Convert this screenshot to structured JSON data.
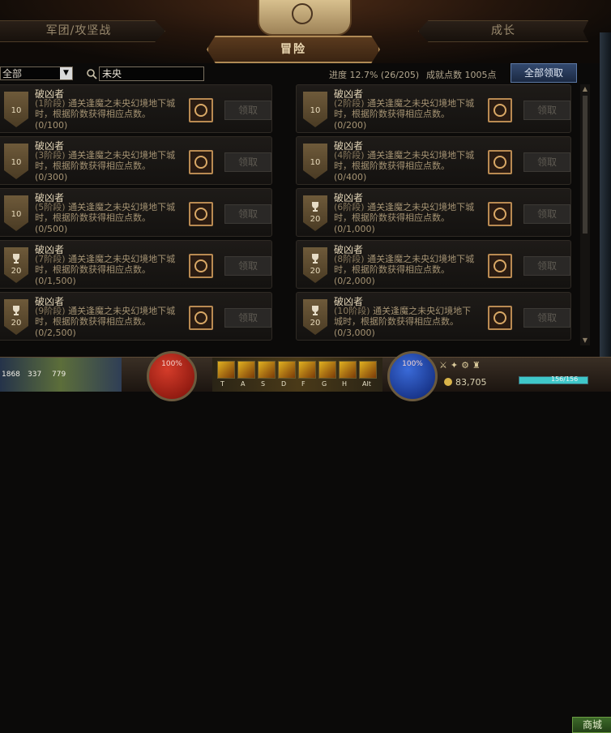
{
  "header": {
    "tab_left": "军团/攻坚战",
    "tab_active": "冒险",
    "tab_right": "成长"
  },
  "filter": {
    "category": "全部",
    "search_value": "未央"
  },
  "summary": {
    "progress": "进度 12.7% (26/205)",
    "points": "成就点数 1005点",
    "claim_all": "全部领取"
  },
  "achievements": [
    {
      "badge": "10",
      "trophy": false,
      "title": "破凶者",
      "stage": "(1阶段)",
      "desc": " 通关逢魔之未央幻境地下城时，根据阶数获得相应点数。",
      "progress": "(0/100)",
      "claim": "领取"
    },
    {
      "badge": "10",
      "trophy": false,
      "title": "破凶者",
      "stage": "(2阶段)",
      "desc": " 通关逢魔之未央幻境地下城时，根据阶数获得相应点数。",
      "progress": "(0/200)",
      "claim": "领取"
    },
    {
      "badge": "10",
      "trophy": false,
      "title": "破凶者",
      "stage": "(3阶段)",
      "desc": " 通关逢魔之未央幻境地下城时，根据阶数获得相应点数。",
      "progress": "(0/300)",
      "claim": "领取"
    },
    {
      "badge": "10",
      "trophy": false,
      "title": "破凶者",
      "stage": "(4阶段)",
      "desc": " 通关逢魔之未央幻境地下城时，根据阶数获得相应点数。",
      "progress": "(0/400)",
      "claim": "领取"
    },
    {
      "badge": "10",
      "trophy": false,
      "title": "破凶者",
      "stage": "(5阶段)",
      "desc": " 通关逢魔之未央幻境地下城时，根据阶数获得相应点数。",
      "progress": "(0/500)",
      "claim": "领取"
    },
    {
      "badge": "20",
      "trophy": true,
      "title": "破凶者",
      "stage": "(6阶段)",
      "desc": " 通关逢魔之未央幻境地下城时，根据阶数获得相应点数。",
      "progress": "(0/1,000)",
      "claim": "领取"
    },
    {
      "badge": "20",
      "trophy": true,
      "title": "破凶者",
      "stage": "(7阶段)",
      "desc": " 通关逢魔之未央幻境地下城时，根据阶数获得相应点数。",
      "progress": "(0/1,500)",
      "claim": "领取"
    },
    {
      "badge": "20",
      "trophy": true,
      "title": "破凶者",
      "stage": "(8阶段)",
      "desc": " 通关逢魔之未央幻境地下城时，根据阶数获得相应点数。",
      "progress": "(0/2,000)",
      "claim": "领取"
    },
    {
      "badge": "20",
      "trophy": true,
      "title": "破凶者",
      "stage": "(9阶段)",
      "desc": " 通关逢魔之未央幻境地下城时，根据阶数获得相应点数。",
      "progress": "(0/2,500)",
      "claim": "领取"
    },
    {
      "badge": "20",
      "trophy": true,
      "title": "破凶者",
      "stage": "(10阶段)",
      "desc": " 通关逢魔之未央幻境地下城时，根据阶数获得相应点数。",
      "progress": "(0/3,000)",
      "claim": "领取"
    }
  ],
  "hud": {
    "stat_1": "1868",
    "stat_2": "337",
    "stat_3": "779",
    "hp_percent": "100%",
    "mp_percent": "100%",
    "gold": "83,705",
    "level_text": "156/156",
    "level_fill": 1.0,
    "shop": "商城",
    "skill_keys": [
      "T",
      "A",
      "S",
      "D",
      "F",
      "G",
      "H",
      "Alt"
    ]
  }
}
